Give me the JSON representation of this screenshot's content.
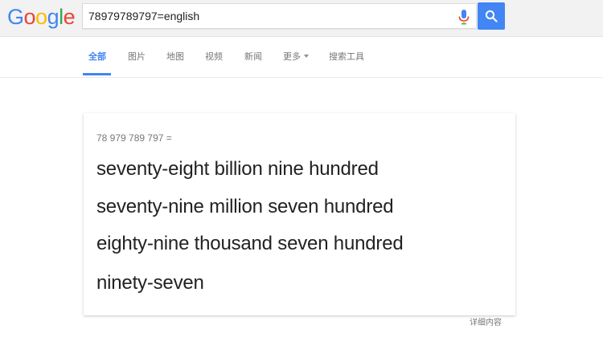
{
  "logo": {
    "letters": [
      "G",
      "o",
      "o",
      "g",
      "l",
      "e"
    ],
    "colors": [
      "#4285f4",
      "#ea4335",
      "#fbbc05",
      "#4285f4",
      "#34a853",
      "#ea4335"
    ]
  },
  "search": {
    "query": "78979789797=english",
    "icons": [
      "mic-icon",
      "search-icon"
    ],
    "button_color": "#4285f4"
  },
  "nav": {
    "tabs": [
      "全部",
      "图片",
      "地图",
      "视频",
      "新闻",
      "更多",
      "搜索工具"
    ],
    "active_tab": "全部",
    "accent": "#4285f4"
  },
  "result": {
    "equation": "78 979 789 797 =",
    "lines": [
      "seventy-eight billion nine hundred",
      "seventy-nine million seven hundred",
      "eighty-nine thousand seven hundred",
      "ninety-seven"
    ],
    "more_link": "详细内容"
  }
}
